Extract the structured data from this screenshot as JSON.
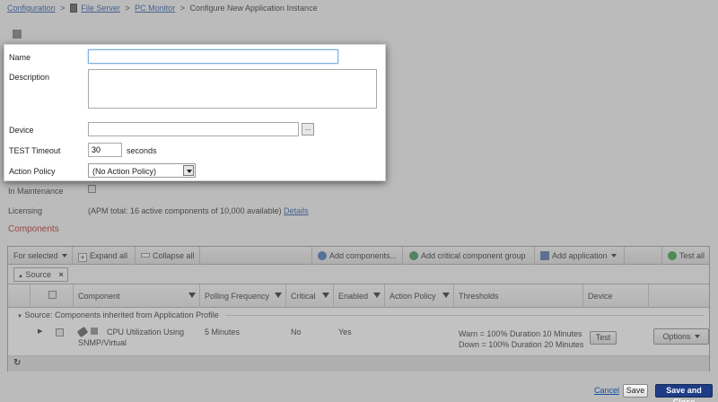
{
  "breadcrumb": {
    "items": [
      "Configuration",
      "File Server",
      "PC Monitor"
    ],
    "current": "Configure New Application Instance",
    "separator": ">"
  },
  "form": {
    "name_label": "Name",
    "name_value": "",
    "description_label": "Description",
    "device_label": "Device",
    "device_browse": "...",
    "timeout_label": "TEST Timeout",
    "timeout_value": "30",
    "timeout_unit": "seconds",
    "action_policy_label": "Action Policy",
    "action_policy_value": "(No Action Policy)",
    "maintenance_label": "In Maintenance",
    "licensing_label": "Licensing",
    "licensing_text": "(APM total: 16 active components of 10,000 available)",
    "licensing_link": "Details"
  },
  "components": {
    "heading": "Components",
    "toolbar": {
      "for_selected": "For selected",
      "expand_all": "Expand all",
      "collapse_all": "Collapse all",
      "add_components": "Add components...",
      "add_critical_group": "Add critical component group",
      "add_application": "Add application",
      "test_all": "Test all"
    },
    "filter_chip": "Source",
    "filter_chip_close": "×",
    "columns": [
      "Component",
      "Polling Frequency",
      "Critical",
      "Enabled",
      "Action Policy",
      "Thresholds",
      "Device"
    ],
    "group_label": "Source: Components inherited from Application Profile",
    "rows": [
      {
        "component_line1": "CPU Utilization Using",
        "component_line2": "SNMP/Virtual",
        "polling": "5 Minutes",
        "critical": "No",
        "enabled": "Yes",
        "action_policy": "",
        "threshold_warn": "Warn = 100% Duration 10 Minutes",
        "threshold_down": "Down = 100% Duration 20 Minutes",
        "test_label": "Test",
        "options_label": "Options"
      }
    ],
    "refresh_icon_label": "↻"
  },
  "footer": {
    "cancel": "Cancel",
    "save": "Save",
    "save_close": "Save and Close"
  },
  "colors": {
    "heading_red": "#b0201f",
    "link_blue": "#1a4fa0",
    "primary_button": "#1f3d86"
  }
}
